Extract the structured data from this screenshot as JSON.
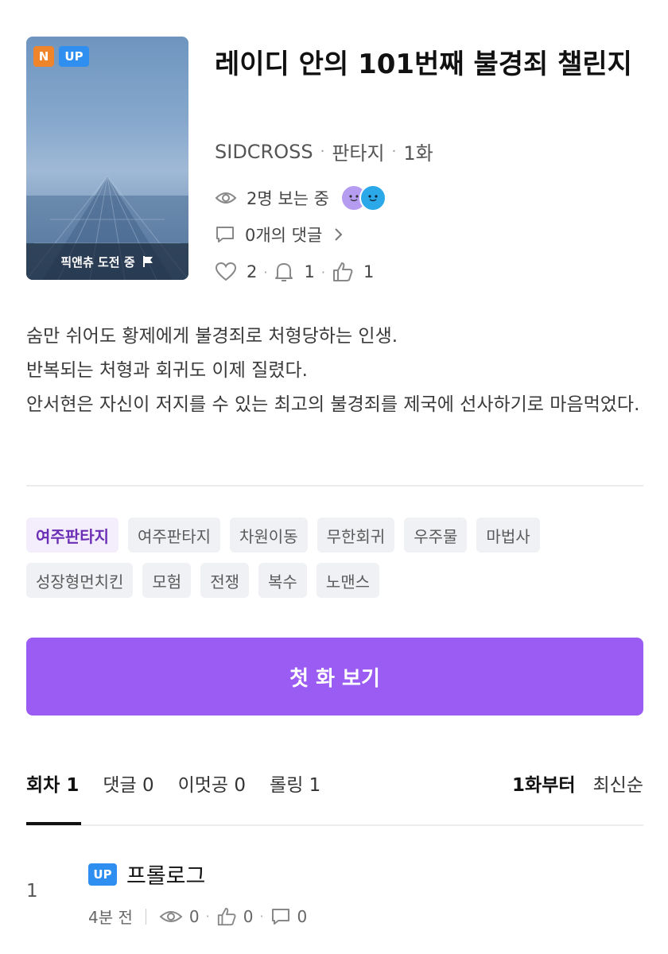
{
  "cover": {
    "badges": [
      "N",
      "UP"
    ],
    "footer_label": "픽앤츄 도전 중"
  },
  "title": "레이디 안의 101번째 불경죄 챌린지",
  "meta": {
    "author": "SIDCROSS",
    "genre": "판타지",
    "episodes": "1화"
  },
  "watching": "2명 보는 중",
  "comments": "0개의 댓글",
  "stats": {
    "likes": "2",
    "subscribers": "1",
    "recommends": "1"
  },
  "synopsis": [
    "숨만 쉬어도 황제에게 불경죄로 처형당하는 인생.",
    "반복되는 처형과 회귀도 이제 질렸다.",
    "안서현은 자신이 저지를 수 있는 최고의 불경죄를 제국에 선사하기로 마음먹었다."
  ],
  "tags": [
    "여주판타지",
    "여주판타지",
    "차원이동",
    "무한회귀",
    "우주물",
    "마법사",
    "성장형먼치킨",
    "모험",
    "전쟁",
    "복수",
    "노맨스"
  ],
  "cta_label": "첫 화 보기",
  "tabs": [
    "회차 1",
    "댓글 0",
    "이멋공 0",
    "롤링 1"
  ],
  "sort": [
    "1화부터",
    "최신순"
  ],
  "episode": {
    "number": "1",
    "badge": "UP",
    "title": "프롤로그",
    "time": "4분 전",
    "views": "0",
    "recommends": "0",
    "comments": "0"
  },
  "colors": {
    "accent": "#9a5cf2",
    "badge_new": "#f0842b",
    "badge_up": "#2f8ff0",
    "tag_highlight_text": "#6b2fb5"
  }
}
